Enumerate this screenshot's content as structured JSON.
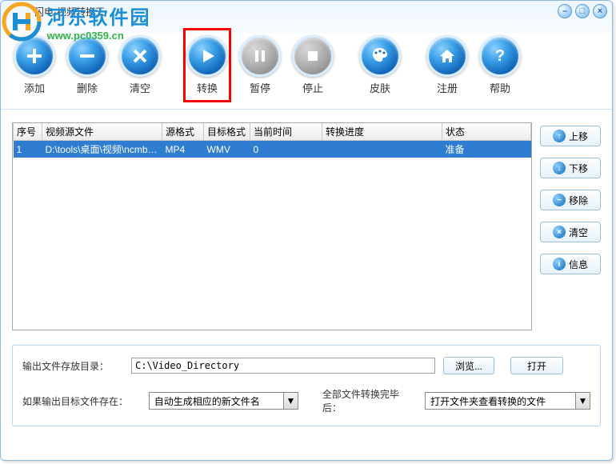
{
  "window": {
    "title": "闪电·视频转换王"
  },
  "watermark": {
    "title": "河东软件园",
    "url": "www.pc0359.cn"
  },
  "toolbar": {
    "add": "添加",
    "delete": "删除",
    "clear": "清空",
    "convert": "转换",
    "pause": "暂停",
    "stop": "停止",
    "skin": "皮肤",
    "register": "注册",
    "help": "帮助"
  },
  "table": {
    "headers": {
      "index": "序号",
      "source": "视频源文件",
      "srcfmt": "源格式",
      "dstfmt": "目标格式",
      "curtime": "当前时间",
      "progress": "转换进度",
      "status": "状态"
    },
    "rows": [
      {
        "index": "1",
        "source": "D:\\tools\\桌面\\视频\\ncmbd...",
        "srcfmt": "MP4",
        "dstfmt": "WMV",
        "curtime": "0",
        "progress": "",
        "status": "准备"
      }
    ]
  },
  "side": {
    "up": "上移",
    "down": "下移",
    "remove": "移除",
    "clear": "清空",
    "info": "信息"
  },
  "bottom": {
    "outdir_label": "输出文件存放目录：",
    "outdir_value": "C:\\Video_Directory",
    "browse": "浏览...",
    "open": "打开",
    "exists_label": "如果输出目标文件存在：",
    "exists_value": "自动生成相应的新文件名",
    "after_label": "全部文件转换完毕后：",
    "after_value": "打开文件夹查看转换的文件"
  }
}
